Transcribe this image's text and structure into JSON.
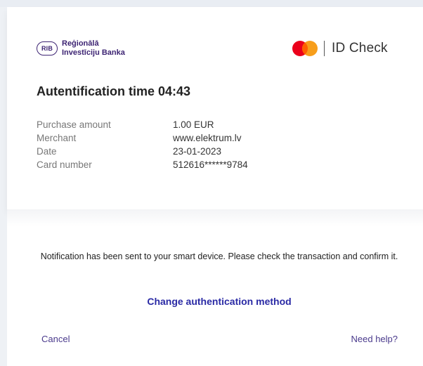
{
  "bank": {
    "badge": "RIB",
    "name_line1": "Reģionālā",
    "name_line2": "Investīciju Banka",
    "color": "#3d2473"
  },
  "brand": {
    "icon": "mastercard-icon",
    "label": "ID Check"
  },
  "title": "Autentification time 04:43",
  "details": [
    {
      "label": "Purchase amount",
      "value": "1.00 EUR"
    },
    {
      "label": "Merchant",
      "value": "www.elektrum.lv"
    },
    {
      "label": "Date",
      "value": "23-01-2023"
    },
    {
      "label": "Card number",
      "value": "512616******9784"
    }
  ],
  "notification": "Notification has been sent to your smart device. Please check the transaction and confirm it.",
  "change_method_label": "Change authentication method",
  "footer": {
    "cancel_label": "Cancel",
    "help_label": "Need help?"
  },
  "colors": {
    "link": "#2a2aa5",
    "footer_link": "#4a3a8c",
    "mc_red": "#eb001b",
    "mc_orange": "#f79e1b"
  }
}
